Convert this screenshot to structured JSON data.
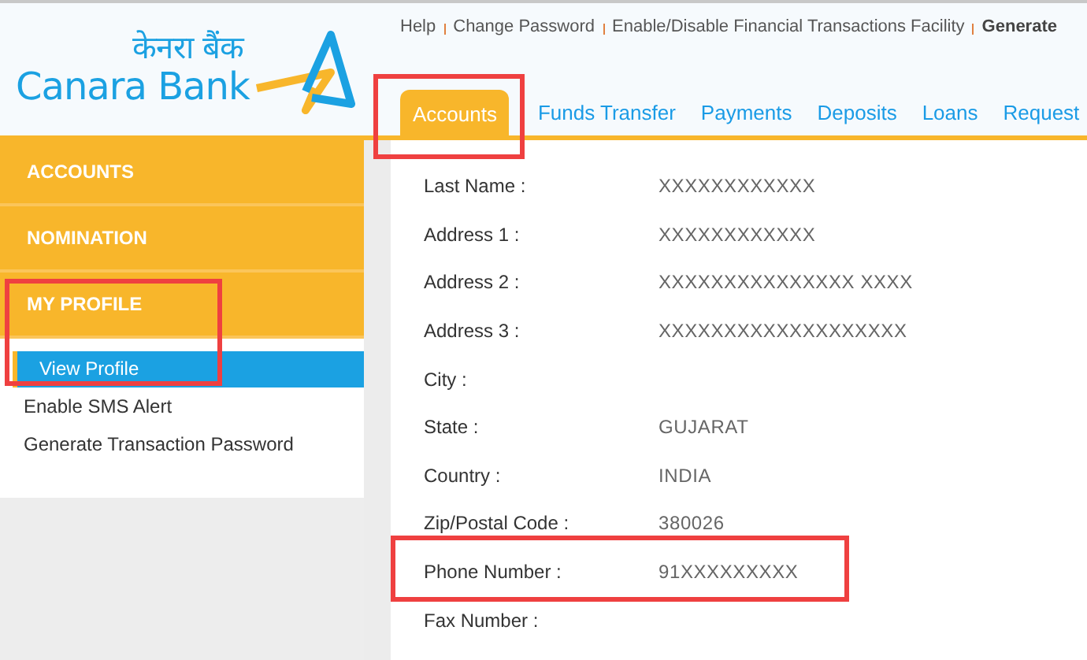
{
  "header": {
    "logo": {
      "hindi": "केनरा बैंक",
      "name": "Canara Bank"
    },
    "top_links": [
      {
        "label": "Help",
        "bold": false
      },
      {
        "label": "Change Password",
        "bold": false
      },
      {
        "label": "Enable/Disable Financial Transactions Facility",
        "bold": false
      },
      {
        "label": "Generate",
        "bold": true
      }
    ],
    "tabs": [
      {
        "label": "Accounts",
        "selected": true,
        "highlighted": true
      },
      {
        "label": "Funds Transfer",
        "selected": false,
        "highlighted": false
      },
      {
        "label": "Payments",
        "selected": false,
        "highlighted": false
      },
      {
        "label": "Deposits",
        "selected": false,
        "highlighted": false
      },
      {
        "label": "Loans",
        "selected": false,
        "highlighted": false
      },
      {
        "label": "Request",
        "selected": false,
        "highlighted": false
      }
    ]
  },
  "sidebar": {
    "sections": [
      {
        "title": "ACCOUNTS",
        "highlighted": false
      },
      {
        "title": "NOMINATION",
        "highlighted": false
      },
      {
        "title": "MY PROFILE",
        "highlighted": true,
        "items": [
          {
            "label": "View Profile",
            "selected": true
          },
          {
            "label": "Enable SMS Alert",
            "selected": false
          },
          {
            "label": "Generate Transaction Password",
            "selected": false
          }
        ]
      }
    ]
  },
  "profile": {
    "fields": [
      {
        "label": "Last Name :",
        "value": "XXXXXXXXXXXX",
        "highlighted": false
      },
      {
        "label": "Address 1 :",
        "value": "XXXXXXXXXXXX",
        "highlighted": false
      },
      {
        "label": "Address 2 :",
        "value": "XXXXXXXXXXXXXXX   XXXX",
        "highlighted": false
      },
      {
        "label": "Address 3 :",
        "value": "XXXXXXXXXXXXXXXXXXX",
        "highlighted": false
      },
      {
        "label": "City :",
        "highlighted": false
      },
      {
        "label": "State :",
        "value": "GUJARAT",
        "highlighted": false
      },
      {
        "label": "Country :",
        "value": "INDIA",
        "highlighted": false
      },
      {
        "label": "Zip/Postal Code :",
        "value": "380026",
        "highlighted": false
      },
      {
        "label": "Phone Number :",
        "value": "91XXXXXXXXX",
        "highlighted": true
      },
      {
        "label": "Fax Number :",
        "highlighted": false
      }
    ]
  }
}
